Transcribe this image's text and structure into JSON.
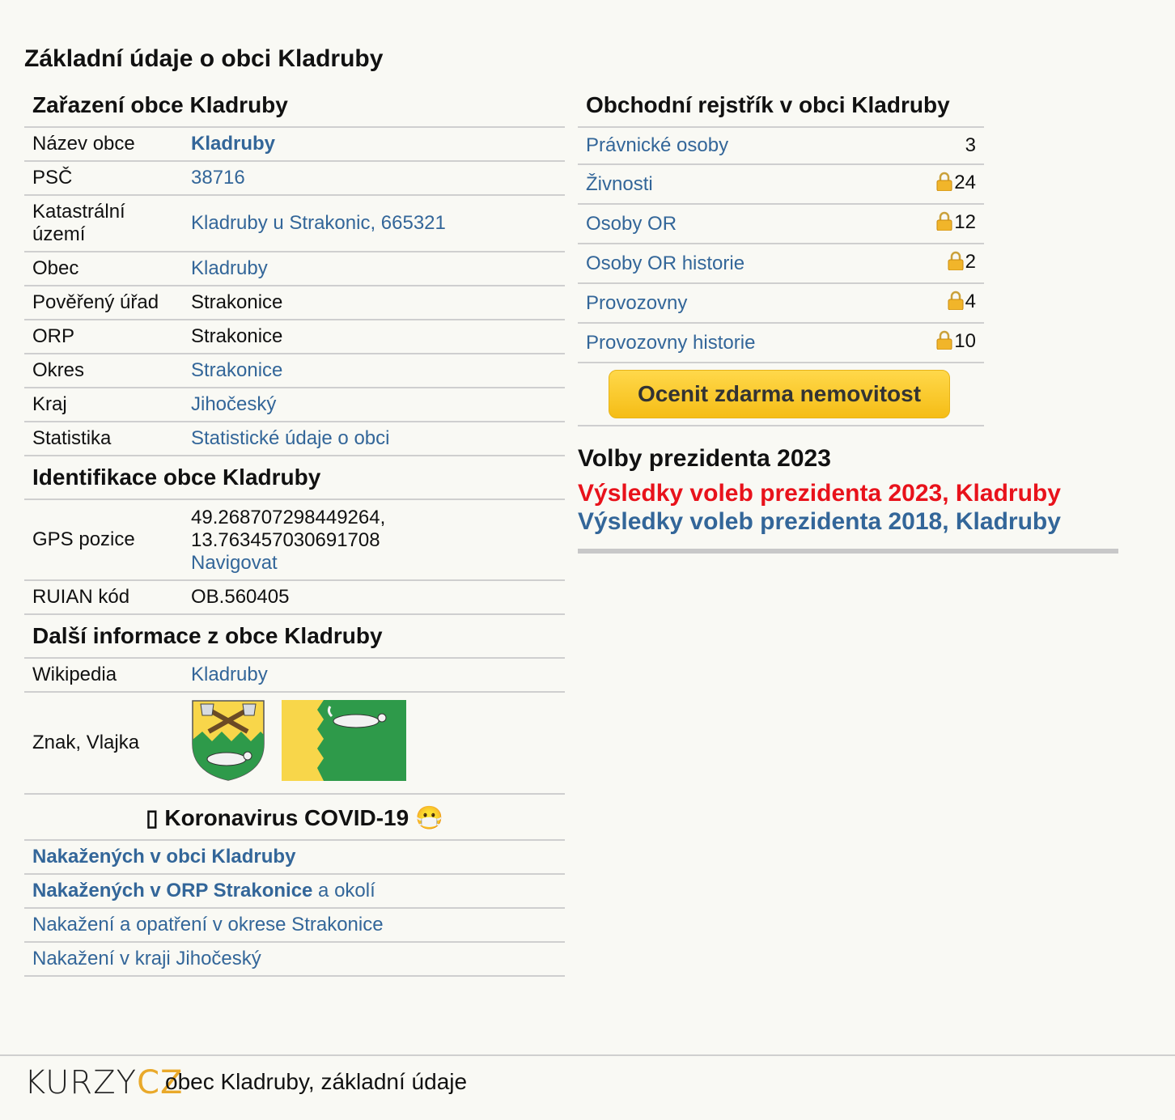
{
  "page_title": "Základní údaje o obci Kladruby",
  "zarazeni": {
    "title": "Zařazení obce Kladruby",
    "rows": [
      {
        "key": "Název obce",
        "value": "Kladruby"
      },
      {
        "key": "PSČ",
        "value": "38716"
      },
      {
        "key": "Katastrální území",
        "value": "Kladruby u Strakonic, 665321"
      },
      {
        "key": "Obec",
        "value": "Kladruby"
      },
      {
        "key": "Pověřený úřad",
        "value": "Strakonice"
      },
      {
        "key": "ORP",
        "value": "Strakonice"
      },
      {
        "key": "Okres",
        "value": "Strakonice"
      },
      {
        "key": "Kraj",
        "value": "Jihočeský"
      },
      {
        "key": "Statistika",
        "value": "Statistické údaje o obci"
      }
    ]
  },
  "identifikace": {
    "title": "Identifikace obce Kladruby",
    "gps_key": "GPS pozice",
    "gps_lat": "49.268707298449264,",
    "gps_lon": "13.763457030691708",
    "navigate": "Navigovat",
    "ruian_key": "RUIAN kód",
    "ruian_value": "OB.560405"
  },
  "dalsi": {
    "title": "Další informace z obce Kladruby",
    "wiki_key": "Wikipedia",
    "wiki_value": "Kladruby",
    "znak_key": "Znak, Vlajka"
  },
  "covid": {
    "title": "▯ Koronavirus COVID-19 😷",
    "row1": "Nakažených v obci Kladruby",
    "row2_bold": "Nakažených v ORP Strakonice",
    "row2_rest": " a okolí",
    "row3": "Nakažení a opatření v okrese Strakonice",
    "row4": "Nakažení v kraji Jihočeský"
  },
  "rejstrik": {
    "title": "Obchodní rejstřík v obci Kladruby",
    "rows": [
      {
        "label": "Právnické osoby",
        "count": "3",
        "locked": false
      },
      {
        "label": "Živnosti",
        "count": "24",
        "locked": true
      },
      {
        "label": "Osoby OR",
        "count": "12",
        "locked": true
      },
      {
        "label": "Osoby OR historie",
        "count": "2",
        "locked": true
      },
      {
        "label": "Provozovny",
        "count": "4",
        "locked": true
      },
      {
        "label": "Provozovny historie",
        "count": "10",
        "locked": true
      }
    ],
    "cta": "Ocenit zdarma nemovitost"
  },
  "volby": {
    "title": "Volby prezidenta 2023",
    "link2023": "Výsledky voleb prezidenta 2023, Kladruby",
    "link2018": "Výsledky voleb prezidenta 2018, Kladruby"
  },
  "footer": {
    "logo_k": "KURZY",
    "logo_c": "CZ",
    "text": "obec Kladruby, základní údaje"
  },
  "colors": {
    "link": "#336699",
    "red_link": "#e8121b",
    "cta": "#f5bd16",
    "background": "#f9f9f4"
  }
}
